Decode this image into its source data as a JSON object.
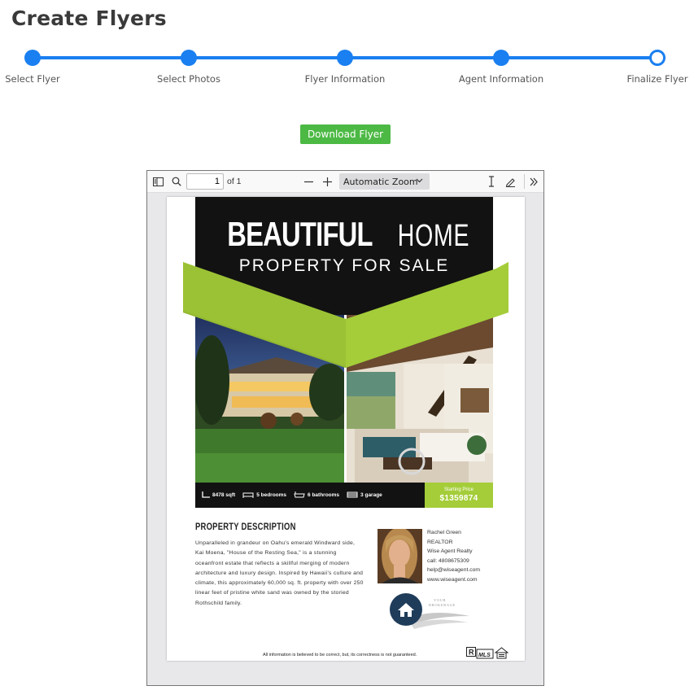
{
  "page": {
    "title": "Create Flyers"
  },
  "stepper": {
    "steps": [
      {
        "label": "Select Flyer",
        "state": "complete"
      },
      {
        "label": "Select Photos",
        "state": "complete"
      },
      {
        "label": "Flyer Information",
        "state": "complete"
      },
      {
        "label": "Agent Information",
        "state": "complete"
      },
      {
        "label": "Finalize Flyer",
        "state": "current"
      }
    ],
    "color": "#1a7ff0"
  },
  "actions": {
    "download_label": "Download Flyer",
    "download_color": "#4cb944"
  },
  "viewer": {
    "toolbar": {
      "page_number": "1",
      "page_of": "of 1",
      "zoom_label": "Automatic Zoom",
      "icons": [
        "sidebar-toggle-icon",
        "search-icon",
        "zoom-out-icon",
        "zoom-in-icon",
        "chevron-down-icon",
        "text-cursor-icon",
        "draw-pen-icon",
        "double-chevron-right-icon"
      ]
    }
  },
  "flyer": {
    "headline_bold": "BEAUTIFUL",
    "headline_light": "HOME",
    "subheadline": "PROPERTY FOR SALE",
    "accent_color": "#a4cd39",
    "features": [
      {
        "icon": "area-icon",
        "text": "8478 sqft"
      },
      {
        "icon": "bed-icon",
        "text": "5 bedrooms"
      },
      {
        "icon": "bathtub-icon",
        "text": "6 bathrooms"
      },
      {
        "icon": "garage-icon",
        "text": "3 garage"
      }
    ],
    "price_label": "Starting Price",
    "price_value": "$1359874",
    "description_title": "PROPERTY DESCRIPTION",
    "description_text": "Unparalleled in grandeur on Oahu's emerald Windward side, Kai Moena, \"House of the Resting Sea,\" is a stunning oceanfront estate that reflects a skillful merging of modern architecture and luxury design. Inspired by Hawaii's culture and climate, this approximately 60,000 sq. ft. property with over 250 linear feet of pristine white sand was owned by the storied Rothschild family.",
    "agent": {
      "name": "Rachel Green",
      "title": "REALTOR",
      "company": "Wise Agent Realty",
      "phone": "call: 4808675309",
      "email": "help@wiseagent.com",
      "website": "www.wiseagent.com"
    },
    "brokerage_logo_text": "YOUR BROKERAGE",
    "disclaimer": "All information is believed to be correct, but, its correctness is not guaranteed."
  }
}
